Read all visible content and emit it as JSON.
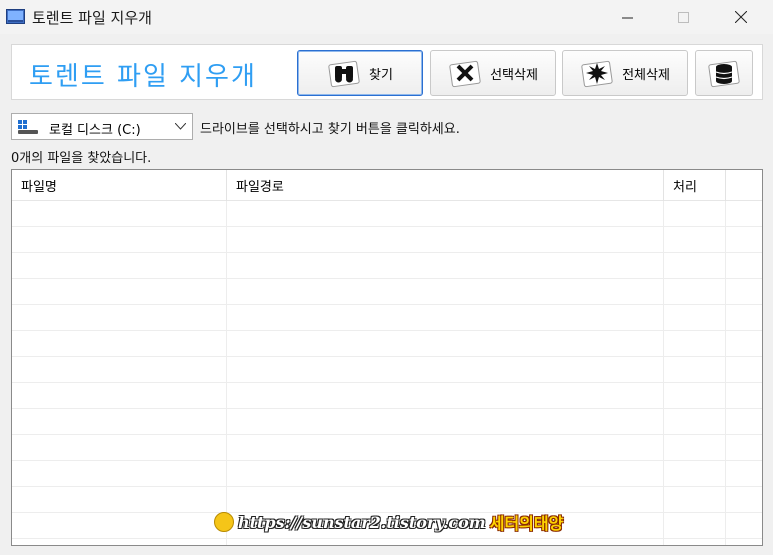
{
  "window": {
    "title": "토렌트 파일 지우개",
    "controls": [
      "minimize",
      "maximize",
      "close"
    ]
  },
  "header": {
    "app_heading": "토렌트 파일 지우개",
    "buttons": [
      {
        "label": "찾기",
        "icon": "binoculars-icon",
        "focused": true
      },
      {
        "label": "선택삭제",
        "icon": "delete-x-icon",
        "focused": false
      },
      {
        "label": "전체삭제",
        "icon": "burst-icon",
        "focused": false
      },
      {
        "label": "",
        "icon": "database-icon",
        "focused": false
      }
    ]
  },
  "drive": {
    "selected": "로컬 디스크 (C:)",
    "icon": "drive-icon",
    "hint": "드라이브를 선택하시고 찾기 버튼을 클릭하세요."
  },
  "status": {
    "found_text": "0개의 파일을 찾았습니다."
  },
  "table": {
    "columns": [
      "파일명",
      "파일경로",
      "처리"
    ],
    "rows": []
  },
  "watermark": {
    "url": "https://sunstar2.tistory.com",
    "blog": "세터의태양"
  },
  "colors": {
    "heading": "#2f9ef3",
    "focus_border": "#2b6fd1",
    "background": "#f0f0f0"
  }
}
